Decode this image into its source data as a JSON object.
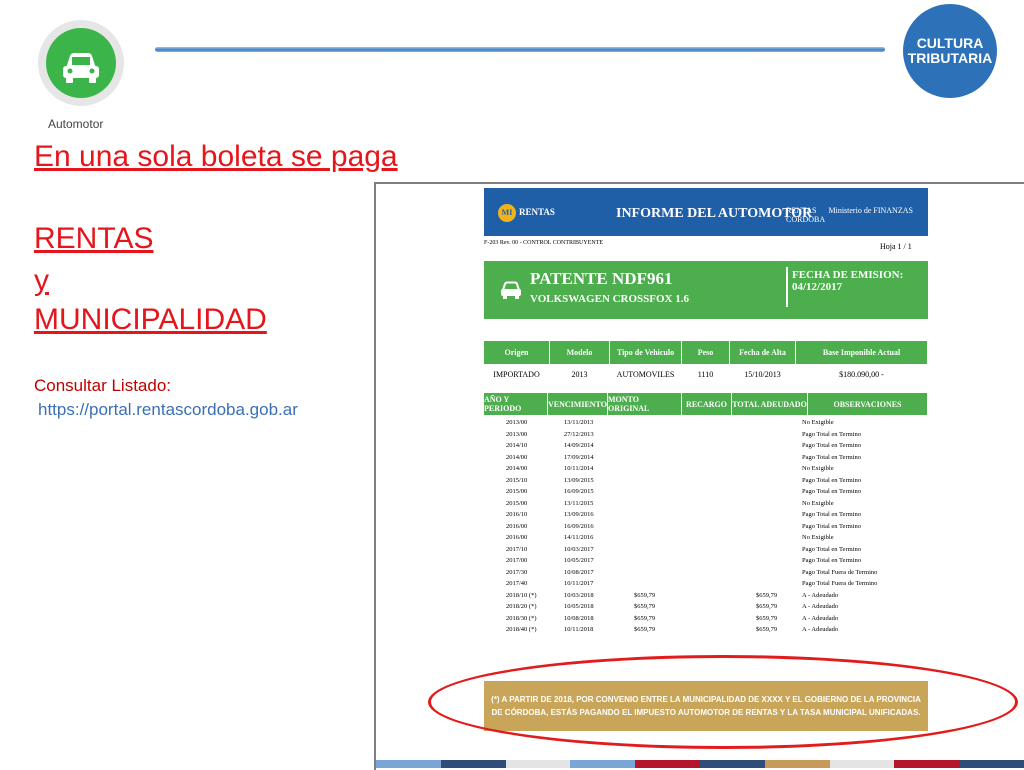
{
  "header": {
    "app_label": "Automotor",
    "badge_line1": "CULTURA",
    "badge_line2": "TRIBUTARIA"
  },
  "left": {
    "headline": "En una sola boleta se paga",
    "line1": "RENTAS",
    "line2": "y",
    "line3": "MUNICIPALIDAD",
    "consult_label": "Consultar Listado:",
    "consult_url": "https://portal.rentascordoba.gob.ar"
  },
  "report": {
    "brand": "RENTAS",
    "brand_mark": "MI",
    "title": "INFORME DEL AUTOMOTOR",
    "logos": [
      "RENTAS",
      "Ministerio de FINANZAS",
      "CÓRDOBA"
    ],
    "form_code": "F-203 Rev. 00 - CONTROL CONTRIBUYENTE",
    "page": "Hoja 1 / 1",
    "plate": "PATENTE NDF961",
    "model": "VOLKSWAGEN CROSSFOX 1.6",
    "emission": "FECHA DE EMISION: 04/12/2017",
    "vehicle_headers": [
      "Origen",
      "Modelo",
      "Tipo de Vehiculo",
      "Peso",
      "Fecha de Alta",
      "Base Imponible Actual"
    ],
    "vehicle_values": [
      "IMPORTADO",
      "2013",
      "AUTOMOVILES",
      "1110",
      "15/10/2013",
      "$180.090,00 -"
    ],
    "movement_headers": [
      "AÑO Y PERIODO",
      "VENCIMIENTO",
      "MONTO ORIGINAL",
      "RECARGO",
      "TOTAL ADEUDADO",
      "OBSERVACIONES"
    ],
    "movements": [
      {
        "period": "2013/00",
        "due": "13/11/2013",
        "amount": "",
        "total": "",
        "obs": "No Exigible"
      },
      {
        "period": "2013/00",
        "due": "27/12/2013",
        "amount": "",
        "total": "",
        "obs": "Pago Total en Termino"
      },
      {
        "period": "2014/10",
        "due": "14/09/2014",
        "amount": "",
        "total": "",
        "obs": "Pago Total en Termino"
      },
      {
        "period": "2014/00",
        "due": "17/09/2014",
        "amount": "",
        "total": "",
        "obs": "Pago Total en Termino"
      },
      {
        "period": "2014/00",
        "due": "10/11/2014",
        "amount": "",
        "total": "",
        "obs": "No Exigible"
      },
      {
        "period": "2015/10",
        "due": "13/09/2015",
        "amount": "",
        "total": "",
        "obs": "Pago Total en Termino"
      },
      {
        "period": "2015/00",
        "due": "16/09/2015",
        "amount": "",
        "total": "",
        "obs": "Pago Total en Termino"
      },
      {
        "period": "2015/00",
        "due": "13/11/2015",
        "amount": "",
        "total": "",
        "obs": "No Exigible"
      },
      {
        "period": "2016/10",
        "due": "13/09/2016",
        "amount": "",
        "total": "",
        "obs": "Pago Total en Termino"
      },
      {
        "period": "2016/00",
        "due": "16/09/2016",
        "amount": "",
        "total": "",
        "obs": "Pago Total en Termino"
      },
      {
        "period": "2016/00",
        "due": "14/11/2016",
        "amount": "",
        "total": "",
        "obs": "No Exigible"
      },
      {
        "period": "2017/10",
        "due": "10/03/2017",
        "amount": "",
        "total": "",
        "obs": "Pago Total en Termino"
      },
      {
        "period": "2017/00",
        "due": "10/05/2017",
        "amount": "",
        "total": "",
        "obs": "Pago Total en Termino"
      },
      {
        "period": "2017/30",
        "due": "10/08/2017",
        "amount": "",
        "total": "",
        "obs": "Pago Total Fuera de Termino"
      },
      {
        "period": "2017/40",
        "due": "10/11/2017",
        "amount": "",
        "total": "",
        "obs": "Pago Total Fuera de Termino"
      },
      {
        "period": "2018/10 (*)",
        "due": "10/03/2018",
        "amount": "$659,79",
        "total": "$659,79",
        "obs": "A - Adeudado"
      },
      {
        "period": "2018/20 (*)",
        "due": "10/05/2018",
        "amount": "$659,79",
        "total": "$659,79",
        "obs": "A - Adeudado"
      },
      {
        "period": "2018/30 (*)",
        "due": "10/08/2018",
        "amount": "$659,79",
        "total": "$659,79",
        "obs": "A - Adeudado"
      },
      {
        "period": "2018/40 (*)",
        "due": "10/11/2018",
        "amount": "$659,79",
        "total": "$659,79",
        "obs": "A - Adeudado"
      }
    ],
    "notice_line1": "(*) A PARTIR DE 2018, POR CONVENIO ENTRE LA MUNICIPALIDAD DE XXXX Y EL GOBIERNO DE LA PROVINCIA",
    "notice_line2": "DE CÓRDOBA, ESTÁS PAGANDO EL IMPUESTO AUTOMOTOR DE RENTAS Y LA TASA MUNICIPAL UNIFICADAS."
  },
  "colors": {
    "accent_red": "#e4151b",
    "report_blue": "#1f5fa8",
    "report_green": "#4cae4c",
    "notice_gold": "#c9a55a",
    "brand_blue": "#2d72b8"
  },
  "footer_colors": [
    "#7aa6d6",
    "#2f4d78",
    "#e4e4e4",
    "#7aa6d6",
    "#b3162d",
    "#2f4d78",
    "#c79a5c",
    "#e4e4e4",
    "#b3162d",
    "#2f4d78"
  ]
}
